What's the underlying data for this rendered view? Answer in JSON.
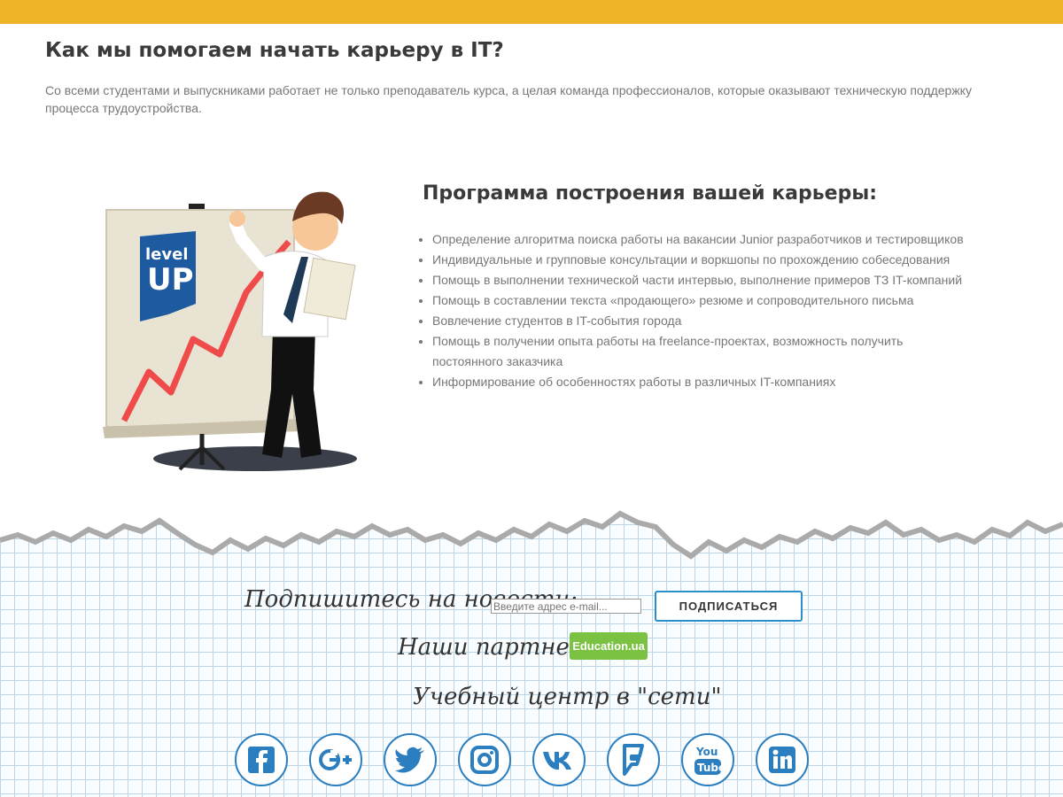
{
  "heading": "Как мы помогаем начать карьеру в IT?",
  "intro": "Со всеми студентами и выпускниками работает не только преподаватель курса, а целая команда профессионалов, которые оказывают техническую поддержку процесса трудоустройства.",
  "illustration": {
    "badge_line1": "level",
    "badge_line2": "UP"
  },
  "program": {
    "title": "Программа построения вашей карьеры:",
    "items": [
      "Определение алгоритма поиска работы на вакансии Junior разработчиков и тестировщиков",
      "Индивидуальные и групповые консультации и воркшопы по прохождению собеседования",
      "Помощь в выполнении технической части интервью, выполнение примеров ТЗ IT-компаний",
      "Помощь в составлении текста «продающего» резюме и сопроводительного письма",
      "Вовлечение студентов в IT-события города",
      "Помощь в получении опыта работы на freelance-проектах, возможность получить постоянного заказчика",
      "Информирование об особенностях работы в различных IT-компаниях"
    ]
  },
  "subscribe": {
    "label": "Подпишитесь на новости:",
    "placeholder": "Введите адрес e-mail...",
    "button": "ПОДПИСАТЬСЯ"
  },
  "partners": {
    "label": "Наши партнеры:",
    "logo_text": "Education.ua"
  },
  "network_label": "Учебный центр в \"сети\"",
  "socials": [
    "facebook-icon",
    "google-plus-icon",
    "twitter-icon",
    "instagram-icon",
    "vk-icon",
    "foursquare-icon",
    "youtube-icon",
    "linkedin-icon"
  ],
  "colors": {
    "top_bar": "#f0b429",
    "accent": "#2b7fc0",
    "partner_green": "#7bc142"
  }
}
